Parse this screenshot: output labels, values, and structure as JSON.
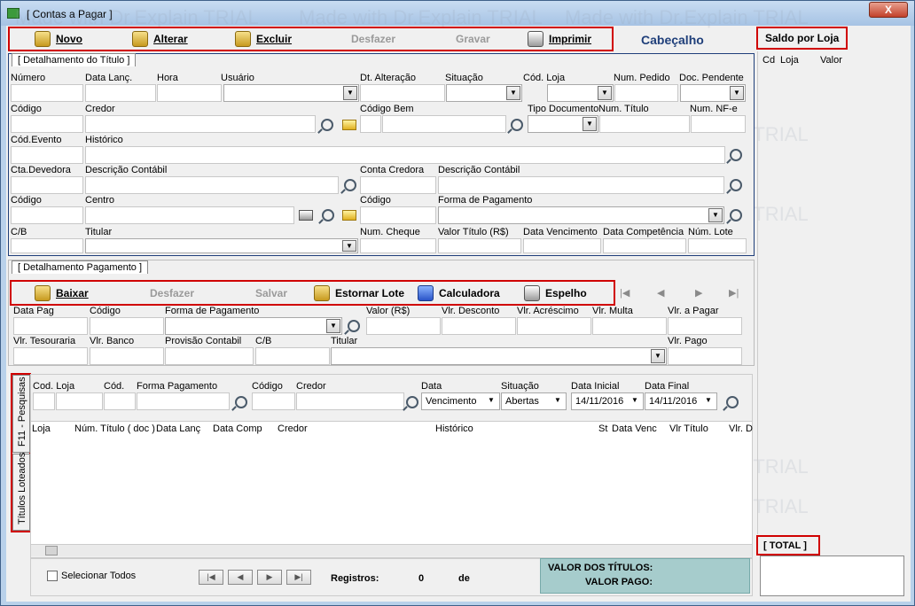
{
  "window": {
    "title": "[ Contas a Pagar ]",
    "close_label": "X"
  },
  "watermark": "Made with Dr.Explain TRIAL",
  "toolbar": {
    "novo": "Novo",
    "alterar": "Alterar",
    "excluir": "Excluir",
    "desfazer": "Desfazer",
    "gravar": "Gravar",
    "imprimir": "Imprimir",
    "cabecalho": "Cabeçalho"
  },
  "saldo": {
    "tab": "Saldo por Loja",
    "cols": [
      "Cd",
      "Loja",
      "Valor"
    ],
    "total_tab": "[ TOTAL ]"
  },
  "titulo": {
    "tab": "[ Detalhamento do Título ]",
    "labels": {
      "numero": "Número",
      "data_lanc": "Data Lanç.",
      "hora": "Hora",
      "usuario": "Usuário",
      "dt_alteracao": "Dt. Alteração",
      "situacao": "Situação",
      "cod_loja": "Cód. Loja",
      "num_pedido": "Num. Pedido",
      "doc_pendente": "Doc. Pendente",
      "codigo": "Código",
      "credor": "Credor",
      "codigo_bem": "Código Bem",
      "tipo_documento": "Tipo Documento",
      "num_titulo": "Num. Título",
      "num_nfe": "Num. NF-e",
      "cod_evento": "Cód.Evento",
      "historico": "Histórico",
      "cta_devedora": "Cta.Devedora",
      "desc_contabil": "Descrição Contábil",
      "conta_credora": "Conta Credora",
      "desc_contabil2": "Descrição Contábil",
      "codigo2": "Código",
      "centro": "Centro",
      "codigo3": "Código",
      "forma_pagamento": "Forma de Pagamento",
      "cb": "C/B",
      "titular": "Titular",
      "num_cheque": "Num. Cheque",
      "valor_titulo": "Valor Título (R$)",
      "data_vencimento": "Data Vencimento",
      "data_competencia": "Data Competência",
      "num_lote": "Núm. Lote"
    }
  },
  "pagamento": {
    "tab": "[ Detalhamento Pagamento ]",
    "toolbar": {
      "baixar": "Baixar",
      "desfazer": "Desfazer",
      "salvar": "Salvar",
      "estornar": "Estornar Lote",
      "calculadora": "Calculadora",
      "espelho": "Espelho"
    },
    "labels": {
      "data_pag": "Data Pag",
      "codigo": "Código",
      "forma_pagamento": "Forma de Pagamento",
      "valor": "Valor (R$)",
      "vlr_desconto": "Vlr. Desconto",
      "vlr_acrescimo": "Vlr. Acréscimo",
      "vlr_multa": "Vlr. Multa",
      "vlr_a_pagar": "Vlr. a Pagar",
      "vlr_tesouraria": "Vlr. Tesouraria",
      "vlr_banco": "Vlr. Banco",
      "provisao": "Provisão Contabil",
      "cb": "C/B",
      "titular": "Titular",
      "vlr_pago": "Vlr. Pago"
    }
  },
  "pesquisa": {
    "vtab1": "F11 - Pesquisas",
    "vtab2": "Títulos Loteados",
    "labels": {
      "cod_loja": "Cod. Loja",
      "cod": "Cód.",
      "forma_pagamento": "Forma Pagamento",
      "codigo": "Código",
      "credor": "Credor",
      "data": "Data",
      "situacao": "Situação",
      "data_inicial": "Data Inicial",
      "data_final": "Data Final"
    },
    "data_value": "Vencimento",
    "situacao_value": "Abertas",
    "data_inicial_value": "14/11/2016",
    "data_final_value": "14/11/2016",
    "columns": [
      "Loja",
      "Núm. Título ( doc )",
      "Data Lanç",
      "Data Comp",
      "Credor",
      "Histórico",
      "St",
      "Data Venc",
      "Vlr Título",
      "Vlr. D"
    ]
  },
  "footer": {
    "selecionar_todos": "Selecionar Todos",
    "registros": "Registros:",
    "registros_value": "0",
    "de": "de",
    "valor_titulos": "VALOR DOS TÍTULOS:",
    "valor_pago": "VALOR PAGO:"
  }
}
